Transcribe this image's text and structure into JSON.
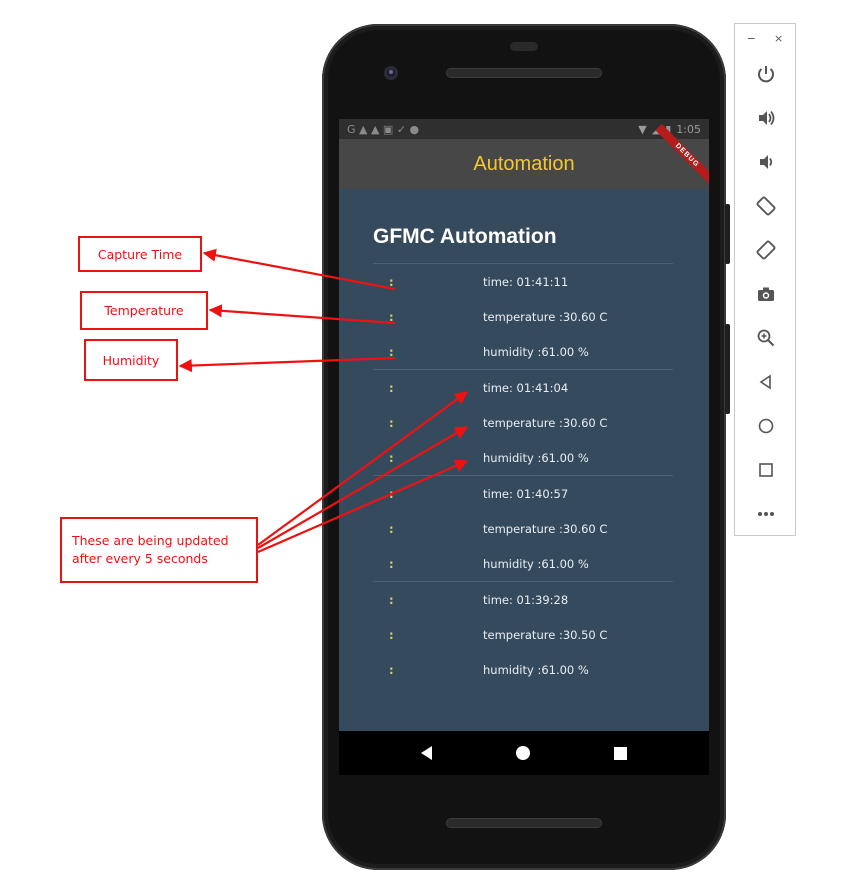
{
  "status_bar": {
    "left_icons": "G ▲ ▲ ▣ ✓ ●",
    "time": "1:05"
  },
  "app_bar": {
    "title": "Automation",
    "debug_banner": "DEBUG"
  },
  "page": {
    "title": "GFMC Automation"
  },
  "readings": [
    {
      "colon": ":",
      "time": "time: 01:41:11",
      "temperature": "temperature :30.60 C",
      "humidity": "humidity :61.00 %"
    },
    {
      "colon": ":",
      "time": "time: 01:41:04",
      "temperature": "temperature :30.60 C",
      "humidity": "humidity :61.00 %"
    },
    {
      "colon": ":",
      "time": "time: 01:40:57",
      "temperature": "temperature :30.60 C",
      "humidity": "humidity :61.00 %"
    },
    {
      "colon": ":",
      "time": "time: 01:39:28",
      "temperature": "temperature :30.50 C",
      "humidity": "humidity :61.00 %"
    }
  ],
  "annotations": {
    "capture_time": "Capture Time",
    "temperature": "Temperature",
    "humidity": "Humidity",
    "updated_line1": "These are being updated",
    "updated_line2": "after every 5 seconds",
    "color": "#e11111"
  },
  "emulator_toolbar": {
    "minimize": "−",
    "close": "×",
    "buttons": [
      "power-icon",
      "volume-up-icon",
      "volume-down-icon",
      "rotate-left-icon",
      "rotate-right-icon",
      "camera-icon",
      "zoom-icon",
      "back-icon",
      "home-icon",
      "overview-icon",
      "more-icon"
    ]
  }
}
